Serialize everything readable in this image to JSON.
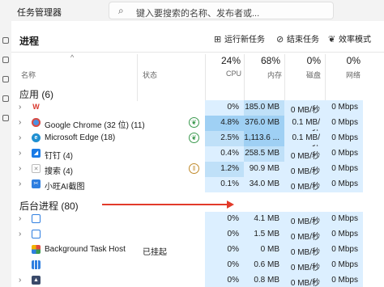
{
  "window": {
    "title": "任务管理器"
  },
  "search": {
    "placeholder": "键入要搜索的名称、发布者或..."
  },
  "page": {
    "title": "进程"
  },
  "toolbar": {
    "run_new_task": "运行新任务",
    "end_task": "结束任务",
    "efficiency_mode": "效率模式"
  },
  "columns": {
    "name": "名称",
    "status": "状态",
    "cpu_pct": "24%",
    "cpu": "CPU",
    "mem_pct": "68%",
    "mem": "内存",
    "disk_pct": "0%",
    "disk": "磁盘",
    "net_pct": "0%",
    "net": "网络"
  },
  "apps_group": {
    "title": "应用 (6)"
  },
  "background_group": {
    "title": "后台进程 (80)"
  },
  "apps": [
    {
      "name": "",
      "icon": "wps-icon",
      "cpu": "0%",
      "mem": "185.0 MB",
      "disk": "0 MB/秒",
      "net": "0 Mbps"
    },
    {
      "name": "Google Chrome (32 位) (11)",
      "icon": "chrome-icon",
      "cpu": "4.8%",
      "mem": "376.0 MB",
      "disk": "0.1 MB/秒",
      "net": "0 Mbps"
    },
    {
      "name": "Microsoft Edge (18)",
      "icon": "edge-icon",
      "cpu": "2.5%",
      "mem": "1,113.6 ...",
      "disk": "0.1 MB/秒",
      "net": "0 Mbps"
    },
    {
      "name": "钉钉 (4)",
      "icon": "dingtalk-icon",
      "cpu": "0.4%",
      "mem": "258.5 MB",
      "disk": "0 MB/秒",
      "net": "0 Mbps"
    },
    {
      "name": "搜索 (4)",
      "icon": "search-app-icon",
      "cpu": "1.2%",
      "mem": "90.9 MB",
      "disk": "0 MB/秒",
      "net": "0 Mbps"
    },
    {
      "name": "小旺AI截图",
      "icon": "screenshot-app-icon",
      "cpu": "0.1%",
      "mem": "34.0 MB",
      "disk": "0 MB/秒",
      "net": "0 Mbps"
    }
  ],
  "background": [
    {
      "name": "",
      "status": "",
      "cpu": "0%",
      "mem": "4.1 MB",
      "disk": "0 MB/秒",
      "net": "0 Mbps"
    },
    {
      "name": "",
      "status": "",
      "cpu": "0%",
      "mem": "1.5 MB",
      "disk": "0 MB/秒",
      "net": "0 Mbps"
    },
    {
      "name": "Background Task Host",
      "status": "已挂起",
      "cpu": "0%",
      "mem": "0 MB",
      "disk": "0 MB/秒",
      "net": "0 Mbps"
    },
    {
      "name": "",
      "status": "",
      "cpu": "0%",
      "mem": "0.6 MB",
      "disk": "0 MB/秒",
      "net": "0 Mbps"
    },
    {
      "name": "",
      "status": "",
      "cpu": "0%",
      "mem": "0.8 MB",
      "disk": "0 MB/秒",
      "net": "0 Mbps"
    }
  ],
  "colors": {
    "heat_light": "#fff4c4",
    "heat_medium": "#ffe9a0",
    "heat_cpu_hi": "#9fd0f4",
    "heat_cpu_mid": "#bfe0f8",
    "heat_cell": "#dcefff",
    "annotation_arrow": "#e23a2a"
  }
}
